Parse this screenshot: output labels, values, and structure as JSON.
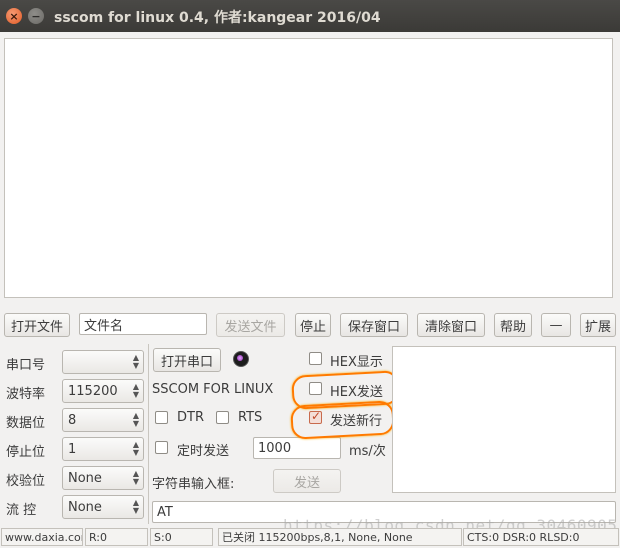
{
  "window": {
    "title": "sscom for linux 0.4, 作者:kangear 2016/04",
    "close_glyph": "×",
    "minimize_glyph": "−"
  },
  "toolbar": {
    "open_file": "打开文件",
    "filename_value": "文件名",
    "send_file": "发送文件",
    "stop": "停止",
    "save_window": "保存窗口",
    "clear_window": "清除窗口",
    "help": "帮助",
    "dash": "—",
    "expand": "扩展"
  },
  "settings": {
    "port_label": "串口号",
    "port_value": "",
    "baud_label": "波特率",
    "baud_value": "115200",
    "databits_label": "数据位",
    "databits_value": "8",
    "stopbits_label": "停止位",
    "stopbits_value": "1",
    "parity_label": "校验位",
    "parity_value": "None",
    "flow_label": "流  控",
    "flow_value": "None"
  },
  "controls": {
    "open_port": "打开串口",
    "brand": "SSCOM FOR LINUX",
    "dtr": "DTR",
    "rts": "RTS",
    "timed_send": "定时发送",
    "interval_value": "1000",
    "interval_unit": "ms/次",
    "hex_display": "HEX显示",
    "hex_send": "HEX发送",
    "send_newline": "发送新行",
    "string_input_label": "字符串输入框:",
    "send": "发送",
    "input_value": "AT",
    "send_newline_checked": true
  },
  "statusbar": {
    "website": "www.daxia.com",
    "rx": "R:0",
    "tx": "S:0",
    "port_status": "已关闭 115200bps,8,1, None, None",
    "lines": "CTS:0  DSR:0  RLSD:0"
  },
  "watermark": "https://blog.csdn.net/qq_30460905",
  "colors": {
    "titlebar": "#3b3a37",
    "annotation": "#ff7a00",
    "checkbox_checked": "#c0492a"
  }
}
